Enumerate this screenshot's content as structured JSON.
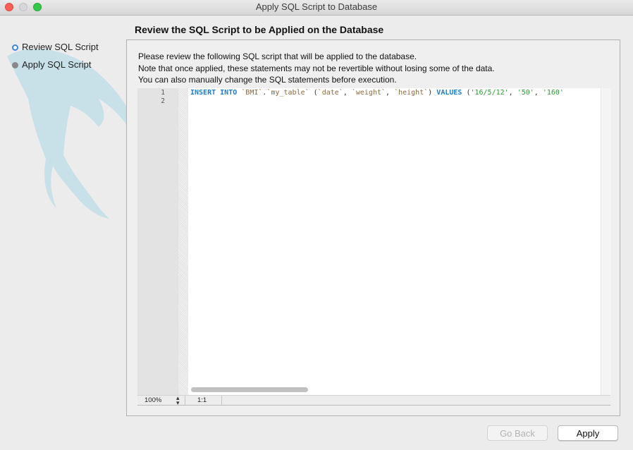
{
  "window": {
    "title": "Apply SQL Script to Database"
  },
  "steps": [
    {
      "label": "Review SQL Script",
      "state": "active"
    },
    {
      "label": "Apply SQL Script",
      "state": "pending"
    }
  ],
  "heading": "Review the SQL Script to be Applied on the Database",
  "description": [
    "Please review the following SQL script that will be applied to the database.",
    "Note that once applied, these statements may not be revertible without losing some of the data.",
    "You can also manually change the SQL statements before execution."
  ],
  "editor": {
    "line_numbers": [
      "1",
      "2"
    ],
    "tokens": [
      {
        "t": "INSERT",
        "c": "kw"
      },
      {
        "t": " ",
        "c": "pn"
      },
      {
        "t": "INTO",
        "c": "kw"
      },
      {
        "t": " ",
        "c": "pn"
      },
      {
        "t": "`BMI`",
        "c": "id"
      },
      {
        "t": ".",
        "c": "pn"
      },
      {
        "t": "`my_table`",
        "c": "id"
      },
      {
        "t": " (",
        "c": "pn"
      },
      {
        "t": "`date`",
        "c": "id"
      },
      {
        "t": ", ",
        "c": "pn"
      },
      {
        "t": "`weight`",
        "c": "id"
      },
      {
        "t": ", ",
        "c": "pn"
      },
      {
        "t": "`height`",
        "c": "id"
      },
      {
        "t": ") ",
        "c": "pn"
      },
      {
        "t": "VALUES",
        "c": "kw"
      },
      {
        "t": " (",
        "c": "pn"
      },
      {
        "t": "'16/5/12'",
        "c": "str"
      },
      {
        "t": ", ",
        "c": "pn"
      },
      {
        "t": "'50'",
        "c": "str"
      },
      {
        "t": ", ",
        "c": "pn"
      },
      {
        "t": "'160'",
        "c": "str"
      }
    ],
    "zoom": "100%",
    "cursor_position": "1:1"
  },
  "buttons": {
    "go_back": "Go Back",
    "apply": "Apply"
  },
  "colors": {
    "keyword": "#1e7fc8",
    "identifier": "#8b6b3c",
    "string": "#2a9c33",
    "active_step": "#3d86d8"
  }
}
